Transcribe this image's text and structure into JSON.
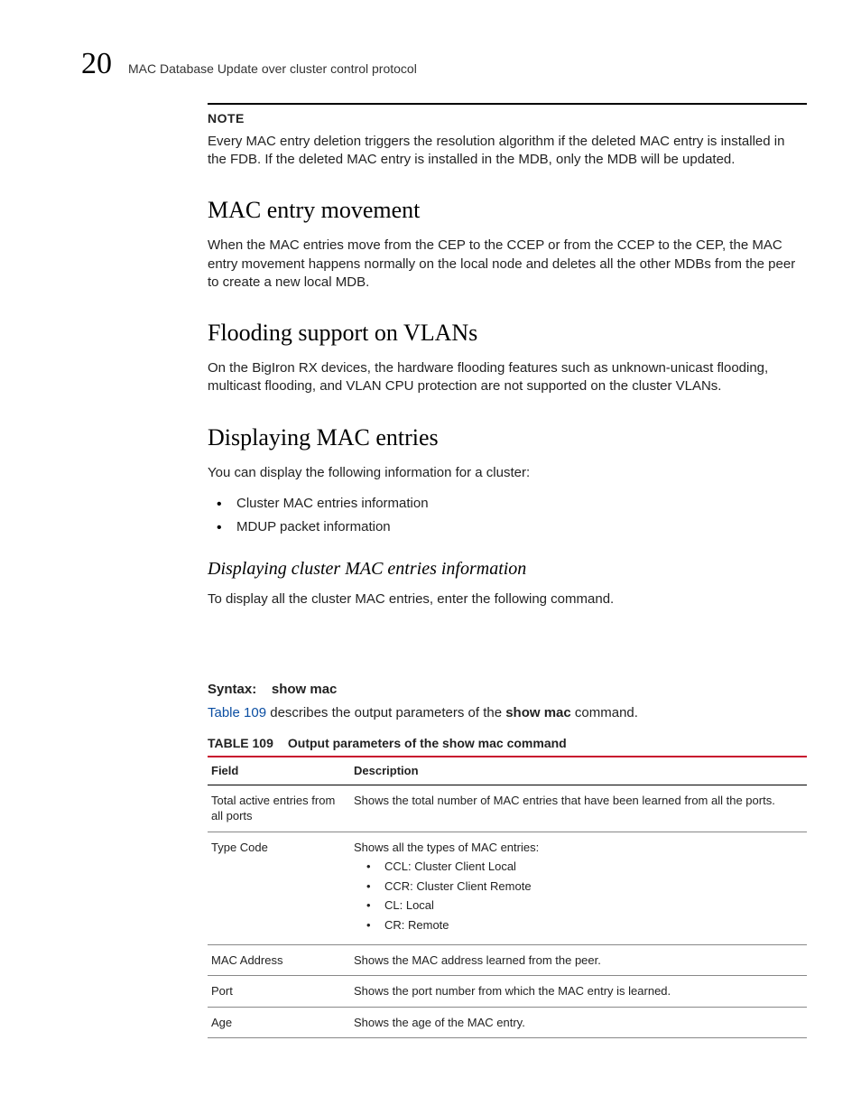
{
  "header": {
    "chapter_number": "20",
    "running_title": "MAC Database Update over cluster control protocol"
  },
  "note": {
    "label": "NOTE",
    "text": "Every MAC entry deletion triggers the resolution algorithm if the deleted MAC entry is installed in the FDB. If the deleted MAC entry is installed in the MDB, only the MDB will be updated."
  },
  "sections": {
    "s1": {
      "heading": "MAC entry movement",
      "body": "When the MAC entries move from the CEP to the CCEP or from the CCEP to the CEP, the MAC entry movement happens normally on the local node and deletes all the other MDBs from the peer to create a new local MDB."
    },
    "s2": {
      "heading": "Flooding support on VLANs",
      "body": "On the BigIron RX devices, the hardware flooding features such as unknown-unicast flooding, multicast flooding, and VLAN CPU protection are not supported on the cluster VLANs."
    },
    "s3": {
      "heading": "Displaying MAC entries",
      "intro": "You can display the following information for a cluster:",
      "bullets": [
        "Cluster MAC entries information",
        "MDUP packet information"
      ],
      "sub": {
        "heading": "Displaying cluster MAC entries information",
        "body": "To display all the cluster MAC entries, enter the following command."
      }
    }
  },
  "syntax": {
    "label": "Syntax:",
    "command": "show mac",
    "desc_pre": "Table 109",
    "desc_mid": " describes the output parameters of the ",
    "desc_cmd": "show mac",
    "desc_post": " command."
  },
  "table": {
    "number": "TABLE 109",
    "caption": "Output parameters of the show mac command",
    "head_field": "Field",
    "head_desc": "Description",
    "rows": [
      {
        "field": "Total active entries from all ports",
        "desc": "Shows the total number of MAC entries that have been learned from all the ports."
      },
      {
        "field": "Type Code",
        "desc": "Shows all the types of MAC entries:",
        "items": [
          "CCL: Cluster Client Local",
          "CCR: Cluster Client Remote",
          "CL: Local",
          "CR: Remote"
        ]
      },
      {
        "field": "MAC Address",
        "desc": "Shows the MAC address learned from the peer."
      },
      {
        "field": "Port",
        "desc": "Shows the port number from which the MAC entry is learned."
      },
      {
        "field": "Age",
        "desc": "Shows the age of the MAC entry."
      }
    ]
  }
}
